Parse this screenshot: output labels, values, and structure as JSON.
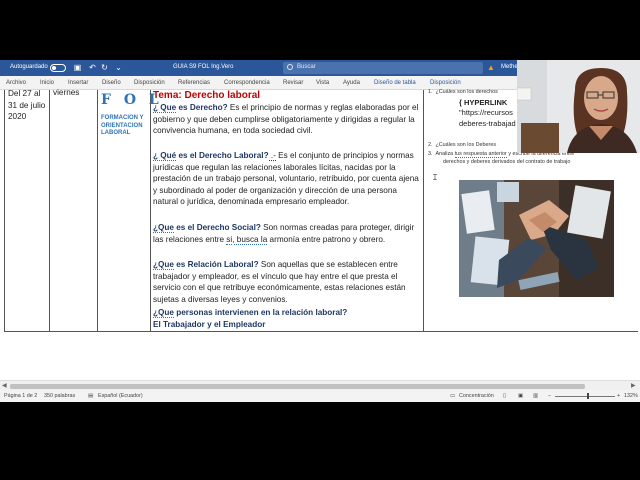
{
  "titlebar": {
    "autosave_label": "Autoguardado",
    "doc_title": "GUIA S9 FOL Ing.Vero",
    "search_placeholder": "Buscar",
    "user": "Methe"
  },
  "menu": [
    "Archivo",
    "Inicio",
    "Insertar",
    "Diseño",
    "Disposición",
    "Referencias",
    "Correspondencia",
    "Revisar",
    "Vista",
    "Ayuda",
    "Diseño de tabla",
    "Disposición"
  ],
  "table": {
    "date": "Del 27 al 31 de julio 2020",
    "day": "viernes",
    "subject_title": "F O L",
    "subject_sub": "FORMACION Y ORIENTACION LABORAL",
    "tema": "Tema: Derecho laboral",
    "q1": {
      "q": "¿ Que",
      "rest_q": " es Derecho?",
      "a": "  Es el principio de normas y reglas elaboradas por el gobierno y que deben cumplirse obligatoriamente y dirigidas a regular la convivencia humana, en toda sociedad civil."
    },
    "q2": {
      "q": "¿ Qué",
      "rest_q": " es el Derecho Laboral?",
      "dash": " .-",
      "a": " Es el conjunto de principios y normas jurídicas que regulan las relaciones laborales lícitas, nacidas por la prestación de un trabajo personal, voluntario, retribuido, por cuenta ajena y subordinado al poder de organización y dirección de una persona natural o jurídica, denominada empresario empleador."
    },
    "q3": {
      "q": "¿Que",
      "rest_q": " es el Derecho Social?",
      "a1": " Son normas creadas para proteger, dirigir las relaciones entre ",
      "si": "si",
      "comma": ",",
      "busca": " busca  la",
      "a2": " armonía entre patrono y obrero."
    },
    "q4": {
      "q": "¿Que",
      "rest_q": " es Relación Laboral?",
      "a": " Son aquellas que se establecen entre trabajador y empleador, es el vínculo que hay entre el que presta el servicio con el que retribuye económicamente, estas relaciones están sujetas a diversas leyes y convenios."
    },
    "q5": {
      "q": "¿Que",
      "rest_q": " personas intervienen en la relación laboral?"
    },
    "q5_answer": "El Trabajador y el Empleador"
  },
  "right_panel": {
    "item1_num": "1.",
    "item1_text": "¿Cuáles son los derechos",
    "hyperlink": "{ HYPERLINK",
    "url": "\"https://recursos",
    "url2": "deberes-trabajad",
    "item2_num": "2.",
    "item2_text": "¿Cuáles son los Deberes",
    "item3_num": "3.",
    "item3_pre": "Analiza ",
    "item3_link": "tus respuesta anterior",
    "item3_post": " y escribe la diferencia entre",
    "item3_line2": "derechos y deberes derivados del contrato de trabajo"
  },
  "statusbar": {
    "page": "Página 1 de 2",
    "words": "350 palabras",
    "lang": "Español (Ecuador)",
    "focus": "Concentración",
    "zoom": "132%"
  },
  "colors": {
    "word_blue": "#2b579a",
    "tema_red": "#c00000",
    "fol_blue": "#2e74b5"
  }
}
